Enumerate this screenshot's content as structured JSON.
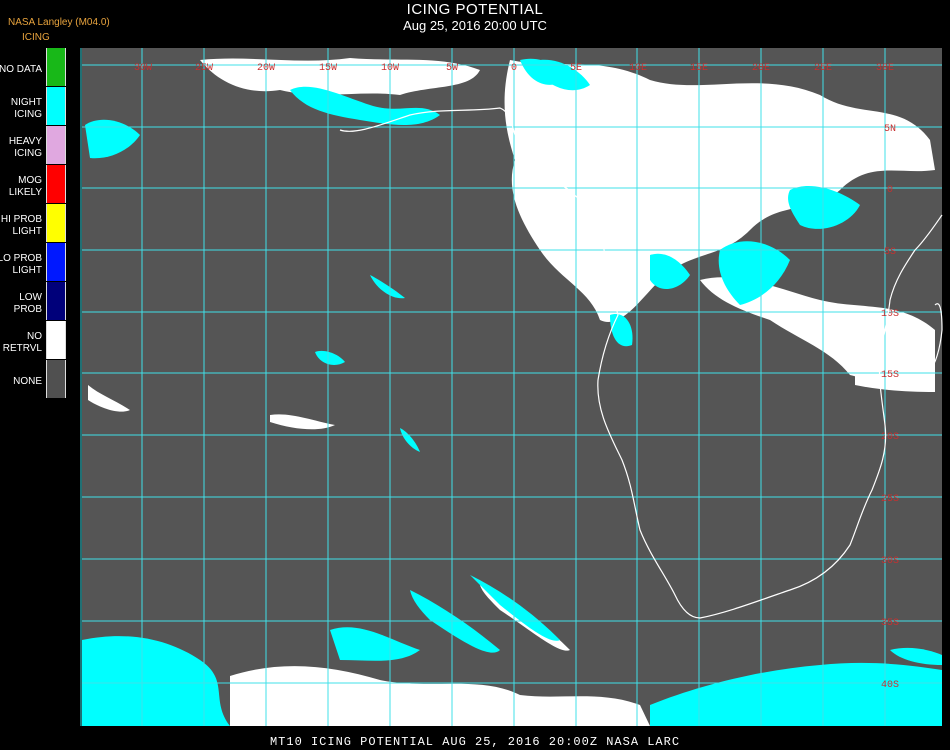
{
  "header": {
    "title": "ICING POTENTIAL",
    "datetime": "Aug 25, 2016 20:00 UTC",
    "agency": "NASA Langley (M04.0)",
    "legend_heading": "ICING"
  },
  "legend": [
    {
      "label": "NO DATA",
      "color": "#18b818"
    },
    {
      "label": "NIGHT\nICING",
      "color": "#00ffff"
    },
    {
      "label": "HEAVY\nICING",
      "color": "#e0a8e0"
    },
    {
      "label": "MOG\nLIKELY",
      "color": "#ff0000"
    },
    {
      "label": "HI PROB\nLIGHT",
      "color": "#ffff00"
    },
    {
      "label": "LO PROB\nLIGHT",
      "color": "#0018ff"
    },
    {
      "label": "LOW\nPROB",
      "color": "#00007a"
    },
    {
      "label": "NO\nRETRVL",
      "color": "#ffffff"
    },
    {
      "label": "NONE",
      "color": "#505050"
    }
  ],
  "map": {
    "background_color": "#555555",
    "grid_color": "#40e0e8",
    "label_color": "#c83030",
    "coast_color": "#ffffff",
    "lon_labels": [
      "30W",
      "25W",
      "20W",
      "15W",
      "10W",
      "5W",
      "0",
      "5E",
      "10E",
      "15E",
      "20E",
      "25E",
      "30E",
      "35E"
    ],
    "lat_labels": [
      "5N",
      "0",
      "5S",
      "10S",
      "15S",
      "20S",
      "25S",
      "30S",
      "35S",
      "40S"
    ]
  },
  "footer": {
    "text": "MT10  ICING POTENTIAL   AUG 25, 2016 20:00Z   NASA LARC"
  }
}
